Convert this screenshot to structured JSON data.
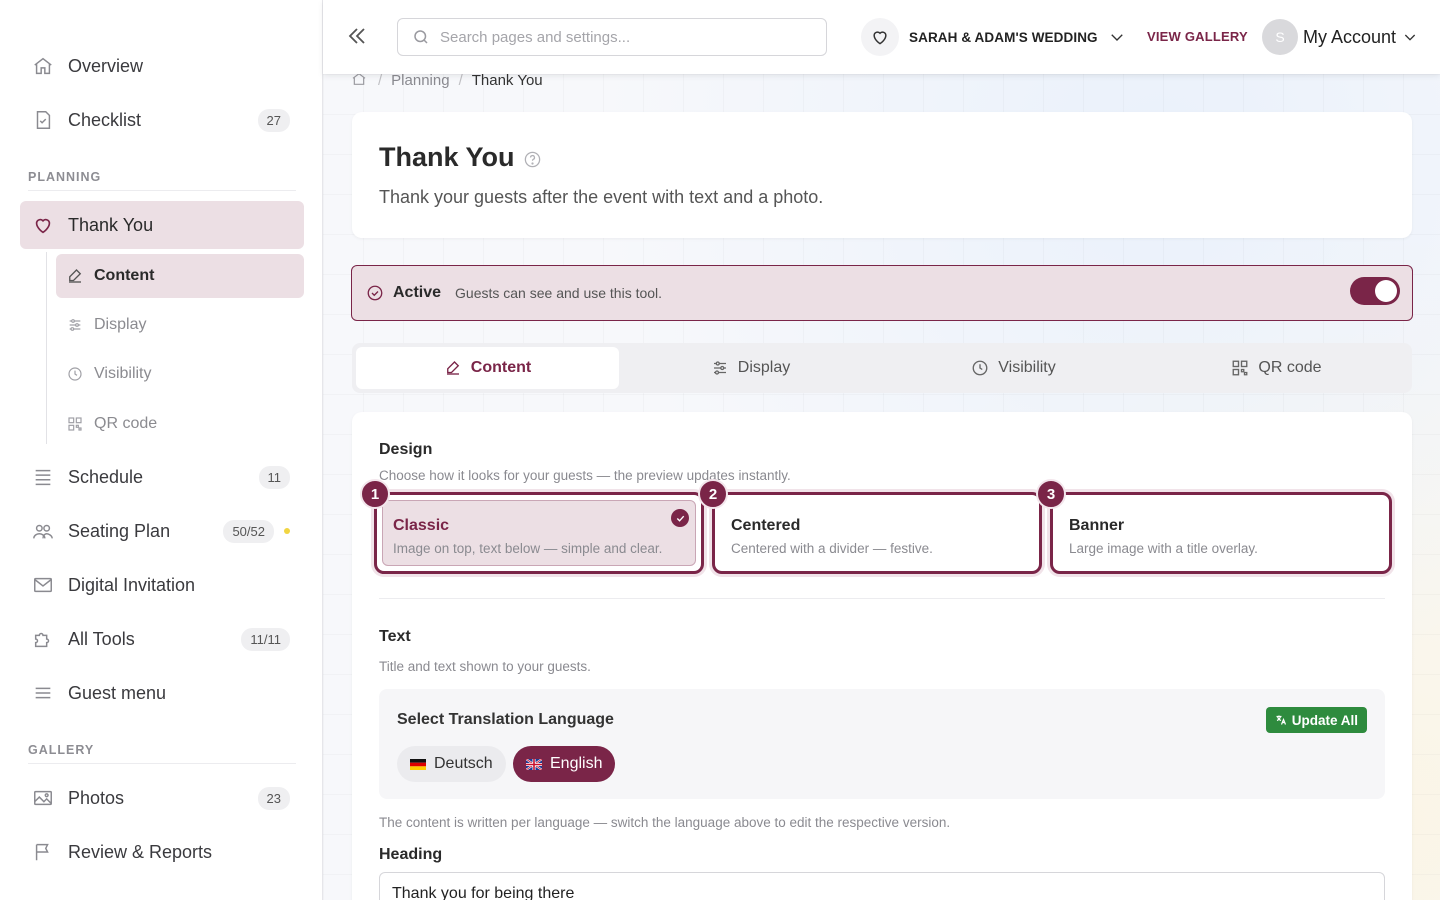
{
  "sidebar": {
    "items": [
      {
        "label": "Overview",
        "icon": "home-icon"
      },
      {
        "label": "Checklist",
        "badge": "27",
        "icon": "checklist-icon"
      }
    ],
    "planning_title": "PLANNING",
    "planning_items": [
      {
        "label": "Thank You",
        "icon": "heart-icon"
      }
    ],
    "sub_items": [
      {
        "label": "Content",
        "icon": "edit-icon"
      },
      {
        "label": "Display",
        "icon": "sliders-icon"
      },
      {
        "label": "Visibility",
        "icon": "clock-icon"
      },
      {
        "label": "QR code",
        "icon": "qr-icon"
      }
    ],
    "more_items": [
      {
        "label": "Schedule",
        "badge": "11",
        "icon": "list-icon"
      },
      {
        "label": "Seating Plan",
        "badge": "50/52",
        "icon": "people-icon"
      },
      {
        "label": "Digital Invitation",
        "icon": "mail-icon"
      },
      {
        "label": "All Tools",
        "badge": "11/11",
        "icon": "puzzle-icon"
      },
      {
        "label": "Guest menu",
        "icon": "menu-icon"
      }
    ],
    "gallery_title": "GALLERY",
    "gallery_items": [
      {
        "label": "Photos",
        "badge": "23",
        "icon": "image-icon"
      },
      {
        "label": "Review & Reports",
        "icon": "flag-icon"
      }
    ],
    "accent_color": "#7a2548",
    "dot_color": "#f1d542"
  },
  "topbar": {
    "search_placeholder": "Search pages and settings...",
    "event_name": "SARAH & ADAM'S WEDDING",
    "view_gallery": "VIEW GALLERY",
    "avatar_initial": "S",
    "account_label": "My Account"
  },
  "breadcrumb": {
    "parent": "Planning",
    "current": "Thank You"
  },
  "page": {
    "title": "Thank You",
    "subtitle": "Thank your guests after the event with text and a photo."
  },
  "status": {
    "title": "Active",
    "description": "Guests can see and use this tool.",
    "enabled": true
  },
  "tabs": [
    {
      "label": "Content",
      "icon": "edit-icon",
      "active": true
    },
    {
      "label": "Display",
      "icon": "sliders-icon",
      "active": false
    },
    {
      "label": "Visibility",
      "icon": "clock-icon",
      "active": false
    },
    {
      "label": "QR code",
      "icon": "qr-icon",
      "active": false
    }
  ],
  "design": {
    "title": "Design",
    "description": "Choose how it looks for your guests — the preview updates instantly.",
    "options": [
      {
        "step": "1",
        "name": "Classic",
        "description": "Image on top, text below — simple and clear.",
        "selected": true
      },
      {
        "step": "2",
        "name": "Centered",
        "description": "Centered with a divider — festive.",
        "selected": false
      },
      {
        "step": "3",
        "name": "Banner",
        "description": "Large image with a title overlay.",
        "selected": false
      }
    ]
  },
  "text_section": {
    "title": "Text",
    "description": "Title and text shown to your guests.",
    "language_title": "Select Translation Language",
    "update_all": "Update All",
    "languages": [
      {
        "label": "Deutsch",
        "active": false
      },
      {
        "label": "English",
        "active": true
      }
    ],
    "note": "The content is written per language — switch the language above to edit the respective version.",
    "heading_label": "Heading",
    "heading_value": "Thank you for being there"
  }
}
